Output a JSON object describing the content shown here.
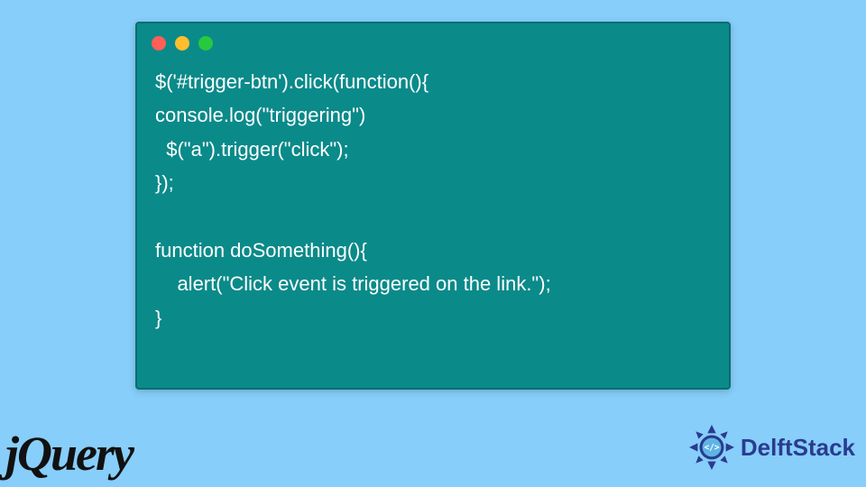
{
  "code": {
    "lines": [
      "$('#trigger-btn').click(function(){",
      "console.log(\"triggering\")",
      "  $(\"a\").trigger(\"click\");",
      "});",
      "",
      "function doSomething(){",
      "    alert(\"Click event is triggered on the link.\");",
      "}"
    ]
  },
  "logos": {
    "jquery": "jQuery",
    "delftstack": "DelftStack"
  },
  "colors": {
    "background": "#87cefa",
    "window": "#0b8a8a",
    "red": "#ff5f56",
    "yellow": "#ffbd2e",
    "green": "#27c93f",
    "logo_accent": "#2a3b8f"
  }
}
